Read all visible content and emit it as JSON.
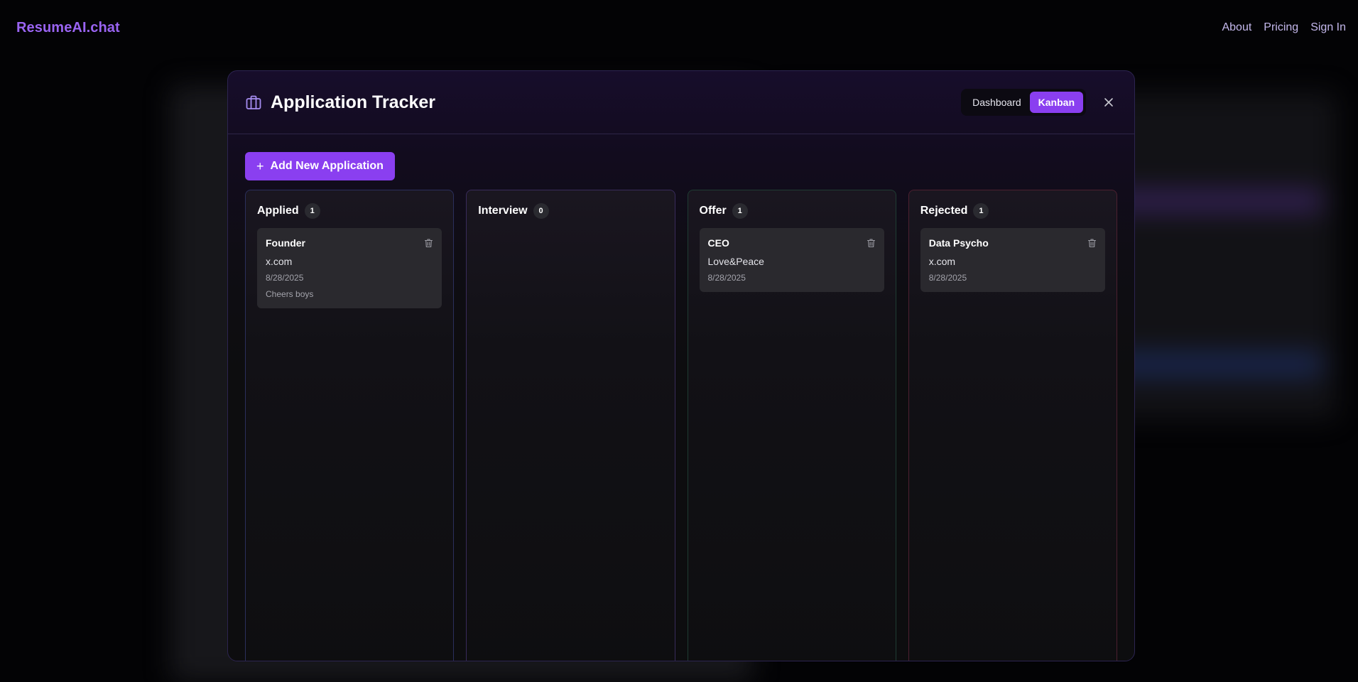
{
  "nav": {
    "brand": "ResumeAI.chat",
    "links": [
      "About",
      "Pricing",
      "Sign In"
    ]
  },
  "modal": {
    "title": "Application Tracker",
    "title_icon": "briefcase-icon",
    "views": {
      "dashboard": "Dashboard",
      "kanban": "Kanban",
      "active": "Kanban"
    },
    "close_icon": "close-icon",
    "add_button": "Add New Application"
  },
  "columns": [
    {
      "title": "Applied",
      "count": "1",
      "color": "#2b2f5c",
      "cards": [
        {
          "role": "Founder",
          "company": "x.com",
          "date": "8/28/2025",
          "note": "Cheers boys"
        }
      ]
    },
    {
      "title": "Interview",
      "count": "0",
      "color": "#392b5b",
      "cards": []
    },
    {
      "title": "Offer",
      "count": "1",
      "color": "#1f3c33",
      "cards": [
        {
          "role": "CEO",
          "company": "Love&Peace",
          "date": "8/28/2025"
        }
      ]
    },
    {
      "title": "Rejected",
      "count": "1",
      "color": "#4c2030",
      "cards": [
        {
          "role": "Data Psycho",
          "company": "x.com",
          "date": "8/28/2025"
        }
      ]
    }
  ],
  "colors": {
    "accent": "#8a3ff0",
    "brand": "#9a64f2",
    "background": "#030305"
  }
}
